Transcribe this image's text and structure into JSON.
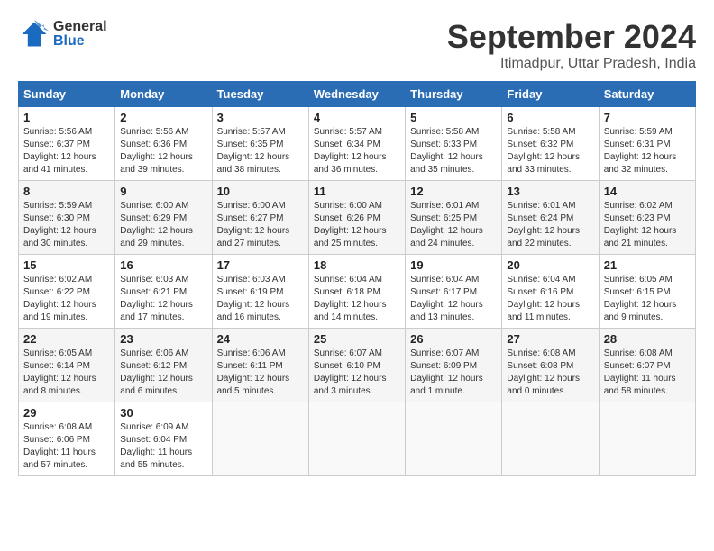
{
  "header": {
    "logo": {
      "line1": "General",
      "line2": "Blue"
    },
    "title": "September 2024",
    "subtitle": "Itimadpur, Uttar Pradesh, India"
  },
  "columns": [
    "Sunday",
    "Monday",
    "Tuesday",
    "Wednesday",
    "Thursday",
    "Friday",
    "Saturday"
  ],
  "weeks": [
    [
      {
        "day": "1",
        "sunrise": "5:56 AM",
        "sunset": "6:37 PM",
        "daylight": "12 hours and 41 minutes."
      },
      {
        "day": "2",
        "sunrise": "5:56 AM",
        "sunset": "6:36 PM",
        "daylight": "12 hours and 39 minutes."
      },
      {
        "day": "3",
        "sunrise": "5:57 AM",
        "sunset": "6:35 PM",
        "daylight": "12 hours and 38 minutes."
      },
      {
        "day": "4",
        "sunrise": "5:57 AM",
        "sunset": "6:34 PM",
        "daylight": "12 hours and 36 minutes."
      },
      {
        "day": "5",
        "sunrise": "5:58 AM",
        "sunset": "6:33 PM",
        "daylight": "12 hours and 35 minutes."
      },
      {
        "day": "6",
        "sunrise": "5:58 AM",
        "sunset": "6:32 PM",
        "daylight": "12 hours and 33 minutes."
      },
      {
        "day": "7",
        "sunrise": "5:59 AM",
        "sunset": "6:31 PM",
        "daylight": "12 hours and 32 minutes."
      }
    ],
    [
      {
        "day": "8",
        "sunrise": "5:59 AM",
        "sunset": "6:30 PM",
        "daylight": "12 hours and 30 minutes."
      },
      {
        "day": "9",
        "sunrise": "6:00 AM",
        "sunset": "6:29 PM",
        "daylight": "12 hours and 29 minutes."
      },
      {
        "day": "10",
        "sunrise": "6:00 AM",
        "sunset": "6:27 PM",
        "daylight": "12 hours and 27 minutes."
      },
      {
        "day": "11",
        "sunrise": "6:00 AM",
        "sunset": "6:26 PM",
        "daylight": "12 hours and 25 minutes."
      },
      {
        "day": "12",
        "sunrise": "6:01 AM",
        "sunset": "6:25 PM",
        "daylight": "12 hours and 24 minutes."
      },
      {
        "day": "13",
        "sunrise": "6:01 AM",
        "sunset": "6:24 PM",
        "daylight": "12 hours and 22 minutes."
      },
      {
        "day": "14",
        "sunrise": "6:02 AM",
        "sunset": "6:23 PM",
        "daylight": "12 hours and 21 minutes."
      }
    ],
    [
      {
        "day": "15",
        "sunrise": "6:02 AM",
        "sunset": "6:22 PM",
        "daylight": "12 hours and 19 minutes."
      },
      {
        "day": "16",
        "sunrise": "6:03 AM",
        "sunset": "6:21 PM",
        "daylight": "12 hours and 17 minutes."
      },
      {
        "day": "17",
        "sunrise": "6:03 AM",
        "sunset": "6:19 PM",
        "daylight": "12 hours and 16 minutes."
      },
      {
        "day": "18",
        "sunrise": "6:04 AM",
        "sunset": "6:18 PM",
        "daylight": "12 hours and 14 minutes."
      },
      {
        "day": "19",
        "sunrise": "6:04 AM",
        "sunset": "6:17 PM",
        "daylight": "12 hours and 13 minutes."
      },
      {
        "day": "20",
        "sunrise": "6:04 AM",
        "sunset": "6:16 PM",
        "daylight": "12 hours and 11 minutes."
      },
      {
        "day": "21",
        "sunrise": "6:05 AM",
        "sunset": "6:15 PM",
        "daylight": "12 hours and 9 minutes."
      }
    ],
    [
      {
        "day": "22",
        "sunrise": "6:05 AM",
        "sunset": "6:14 PM",
        "daylight": "12 hours and 8 minutes."
      },
      {
        "day": "23",
        "sunrise": "6:06 AM",
        "sunset": "6:12 PM",
        "daylight": "12 hours and 6 minutes."
      },
      {
        "day": "24",
        "sunrise": "6:06 AM",
        "sunset": "6:11 PM",
        "daylight": "12 hours and 5 minutes."
      },
      {
        "day": "25",
        "sunrise": "6:07 AM",
        "sunset": "6:10 PM",
        "daylight": "12 hours and 3 minutes."
      },
      {
        "day": "26",
        "sunrise": "6:07 AM",
        "sunset": "6:09 PM",
        "daylight": "12 hours and 1 minute."
      },
      {
        "day": "27",
        "sunrise": "6:08 AM",
        "sunset": "6:08 PM",
        "daylight": "12 hours and 0 minutes."
      },
      {
        "day": "28",
        "sunrise": "6:08 AM",
        "sunset": "6:07 PM",
        "daylight": "11 hours and 58 minutes."
      }
    ],
    [
      {
        "day": "29",
        "sunrise": "6:08 AM",
        "sunset": "6:06 PM",
        "daylight": "11 hours and 57 minutes."
      },
      {
        "day": "30",
        "sunrise": "6:09 AM",
        "sunset": "6:04 PM",
        "daylight": "11 hours and 55 minutes."
      },
      null,
      null,
      null,
      null,
      null
    ]
  ]
}
